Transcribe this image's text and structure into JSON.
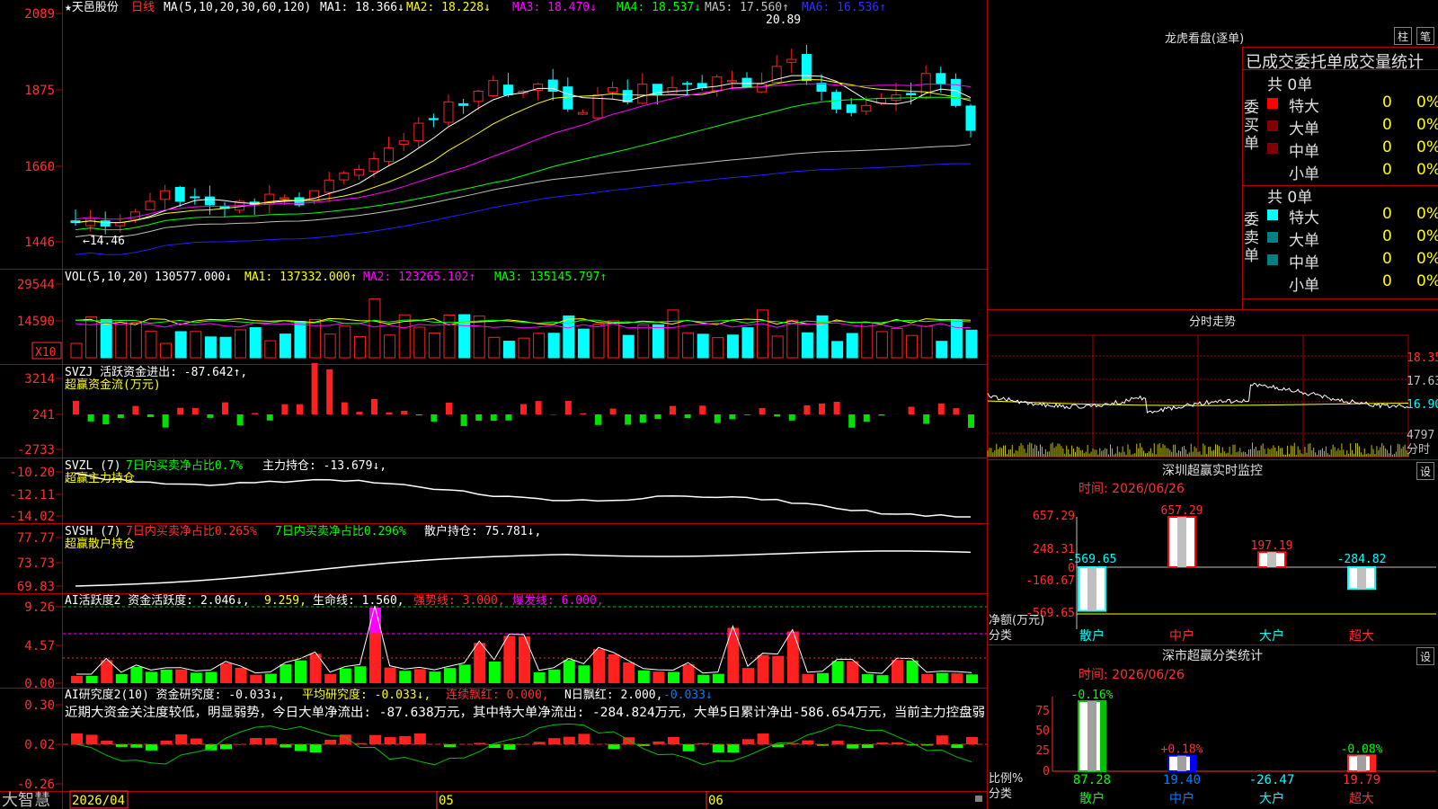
{
  "stock": {
    "name": "★天邑股份",
    "period": "日线",
    "ma_params": "MA(5,10,20,30,60,120)",
    "ma_values": [
      {
        "label": "MA1: 18.366↓",
        "color": "#ffffff"
      },
      {
        "label": "MA2: 18.228↓",
        "color": "#ffff00"
      },
      {
        "label": "MA3: 18.470↓",
        "color": "#ff00ff"
      },
      {
        "label": "MA4: 18.537↓",
        "color": "#00ff00"
      },
      {
        "label": "MA5: 17.560↑",
        "color": "#c0c0c0"
      },
      {
        "label": "MA6: 16.536↑",
        "color": "#0000ff"
      }
    ],
    "high_label": "20.89",
    "low_label": "←14.46",
    "price_axis": [
      "2089",
      "1875",
      "1660",
      "1446"
    ],
    "date_axis": [
      "2026/04",
      "05",
      "06"
    ]
  },
  "vol": {
    "header": "VOL(5,10,20)",
    "value": "130577.000↓",
    "ma": [
      {
        "label": "MA1: 137332.000↑",
        "color": "#ffff00"
      },
      {
        "label": "MA2: 123265.102↑",
        "color": "#ff00ff"
      },
      {
        "label": "MA3: 135145.797↑",
        "color": "#00ff00"
      }
    ],
    "axis": [
      "29544",
      "14590"
    ],
    "unit": "X10"
  },
  "svzj": {
    "header": "SVZJ  活跃资金进出: -87.642↑,",
    "sub": "超赢资金流(万元)",
    "axis": [
      "3214",
      "241",
      "-2733"
    ]
  },
  "svzl": {
    "header": "SVZL (7)",
    "part1": "7日内买卖净占比0.7%",
    "part2": "主力持仓: -13.679↓,",
    "sub": "超赢主力持仓",
    "axis": [
      "-10.20",
      "-12.11",
      "-14.02"
    ]
  },
  "svsh": {
    "header": "SVSH (7)",
    "part1": "7日内买卖净占比0.265%",
    "part2": "7日内买卖净占比0.296%",
    "part3": "散户持仓: 75.781↓,",
    "sub": "超赢散户持仓",
    "axis": [
      "77.77",
      "73.73",
      "69.83"
    ]
  },
  "ai1": {
    "header": "AI活跃度2 资金活跃度: 2.046↓,",
    "v2": "9.259,",
    "v3": "生命线: 1.560,",
    "v4": "强势线: 3.000,",
    "v5": "爆发线: 6.000,",
    "axis": [
      "9.26",
      "4.57",
      "0.00"
    ]
  },
  "ai2": {
    "header": "AI研究度2(10) 资金研究度: -0.033↓,",
    "v2": "平均研究度: -0.033↓,",
    "v3": "连续飘红: 0.000,",
    "v4": "N日飘红: 2.000,",
    "v5": "-0.033↓",
    "desc": "近期大资金关注度较低，明显弱势，今日大单净流出: -87.638万元，其中特大单净流出: -284.824万元，大单5日累计净出-586.654万元，当前主力控盘弱",
    "axis": [
      "0.30",
      "0.02",
      "-0.26"
    ]
  },
  "logo": "大智慧",
  "lhb": {
    "title": "龙虎看盘(逐单)",
    "btn1": "柱",
    "btn2": "笔",
    "subtitle": "已成交委托单成交量统计",
    "buy_label": "委买单",
    "sell_label": "委卖单",
    "buy_total": "共 0单",
    "sell_total": "共 0单",
    "buy_rows": [
      {
        "name": "特大",
        "count": "0",
        "pct": "0%",
        "color": "#ff0000"
      },
      {
        "name": "大单",
        "count": "0",
        "pct": "0%",
        "color": "#800000"
      },
      {
        "name": "中单",
        "count": "0",
        "pct": "0%",
        "color": "#800000"
      },
      {
        "name": "小单",
        "count": "0",
        "pct": "0%",
        "color": "#000000"
      }
    ],
    "sell_rows": [
      {
        "name": "特大",
        "count": "0",
        "pct": "0%",
        "color": "#00ffff"
      },
      {
        "name": "大单",
        "count": "0",
        "pct": "0%",
        "color": "#008080"
      },
      {
        "name": "中单",
        "count": "0",
        "pct": "0%",
        "color": "#008080"
      },
      {
        "name": "小单",
        "count": "0",
        "pct": "0%",
        "color": "#000000"
      }
    ]
  },
  "fenshi": {
    "title": "分时走势",
    "axis": [
      "18.35",
      "17.63",
      "16.90"
    ],
    "vol": "4797",
    "unit": "分时"
  },
  "szjk": {
    "title": "深圳超赢实时监控",
    "btn": "设",
    "time": "时间: 2026/06/26",
    "axis": [
      "657.29",
      "248.31",
      "0",
      "-160.67",
      "-569.65"
    ],
    "bars": [
      {
        "label": "-569.65",
        "value": -569.65,
        "color": "#00ffff"
      },
      {
        "label": "657.29",
        "value": 657.29,
        "color": "#ff0000"
      },
      {
        "label": "197.19",
        "value": 197.19,
        "color": "#ff0000"
      },
      {
        "label": "-284.82",
        "value": -284.82,
        "color": "#00ffff"
      }
    ],
    "ylabel": "净额(万元)",
    "xlabel": "分类",
    "cats": [
      "散户",
      "中户",
      "大户",
      "超大"
    ]
  },
  "scfl": {
    "title": "深市超赢分类统计",
    "btn": "设",
    "time": "时间: 2026/06/26",
    "axis": [
      "75",
      "50",
      "25",
      "0"
    ],
    "top_labels": [
      "-0.16%",
      "+0.18%",
      "",
      "-0.08%"
    ],
    "bottom_labels": [
      "87.28",
      "19.40",
      "-26.47",
      "19.79"
    ],
    "values": [
      87.28,
      19.4,
      -26.47,
      19.79
    ],
    "ylabel": "比例%",
    "xlabel": "分类",
    "cats": [
      "散户",
      "中户",
      "大户",
      "超大"
    ]
  }
}
